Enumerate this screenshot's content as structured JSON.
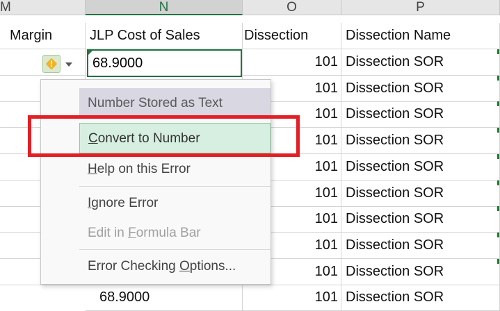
{
  "columns": [
    {
      "letter": "M",
      "header": "Margin"
    },
    {
      "letter": "N",
      "header": "JLP Cost of Sales"
    },
    {
      "letter": "O",
      "header": "Dissection"
    },
    {
      "letter": "P",
      "header": "Dissection Name"
    }
  ],
  "active_cell": {
    "value": "68.9000"
  },
  "rows": [
    {
      "dissection": "101",
      "name": "Dissection SOR"
    },
    {
      "dissection": "101",
      "name": "Dissection SOR"
    },
    {
      "dissection": "101",
      "name": "Dissection SOR"
    },
    {
      "dissection": "101",
      "name": "Dissection SOR"
    },
    {
      "dissection": "101",
      "name": "Dissection SOR"
    },
    {
      "dissection": "101",
      "name": "Dissection SOR"
    },
    {
      "dissection": "101",
      "name": "Dissection SOR"
    },
    {
      "dissection": "101",
      "name": "Dissection SOR"
    },
    {
      "dissection": "101",
      "name": "Dissection SOR"
    }
  ],
  "partial_row": {
    "cost": "68.9000",
    "dissection": "101",
    "name": "Dissection SOR"
  },
  "error_button": {
    "icon": "warning-icon",
    "symbol": "!"
  },
  "menu": {
    "title": "Number Stored as Text",
    "items": [
      {
        "pre": "",
        "key": "C",
        "post": "onvert to Number"
      },
      {
        "pre": "",
        "key": "H",
        "post": "elp on this Error"
      },
      {
        "pre": "",
        "key": "I",
        "post": "gnore Error"
      },
      {
        "pre": "Edit in ",
        "key": "F",
        "post": "ormula Bar"
      },
      {
        "pre": "Error Checking ",
        "key": "O",
        "post": "ptions..."
      }
    ]
  },
  "colors": {
    "excel_green": "#217346",
    "highlight": "#e31e25"
  }
}
